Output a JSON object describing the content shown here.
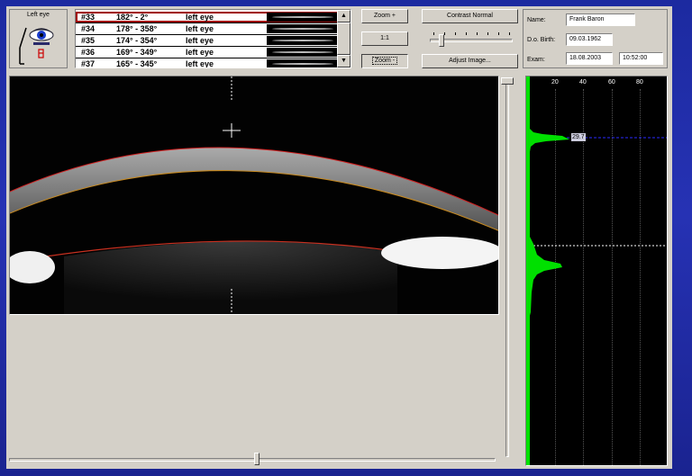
{
  "eye_panel": {
    "label": "Left eye"
  },
  "scan_list": {
    "rows": [
      {
        "id": "#33",
        "angle": "182° - 2°",
        "eye": "left eye",
        "selected": true
      },
      {
        "id": "#34",
        "angle": "178° - 358°",
        "eye": "left eye",
        "selected": false
      },
      {
        "id": "#35",
        "angle": "174° - 354°",
        "eye": "left eye",
        "selected": false
      },
      {
        "id": "#36",
        "angle": "169° - 349°",
        "eye": "left eye",
        "selected": false
      },
      {
        "id": "#37",
        "angle": "165° - 345°",
        "eye": "left eye",
        "selected": false
      }
    ],
    "scroll_up": "▲",
    "scroll_down": "▼"
  },
  "controls": {
    "zoom_in": "Zoom +",
    "one_to_one": "1:1",
    "zoom_out": "Zoom -",
    "contrast": "Contrast Normal",
    "adjust_image": "Adjust Image..."
  },
  "patient": {
    "name_label": "Name:",
    "name": "Frank Baron",
    "dob_label": "D.o. Birth:",
    "dob": "09.03.1962",
    "exam_label": "Exam:",
    "exam_date": "18.08.2003",
    "exam_time": "10:52:00"
  },
  "graph": {
    "axis_labels": [
      "20",
      "40",
      "60",
      "80"
    ],
    "peak_value": "29.7",
    "colors": {
      "fill": "#00e000",
      "background": "#000000",
      "marker": "#2a2aff"
    }
  },
  "colors": {
    "desktop": "#2632b4",
    "window": "#d4d0c8",
    "selection_outline": "#a00000",
    "overlay_curve": "#d02020"
  }
}
